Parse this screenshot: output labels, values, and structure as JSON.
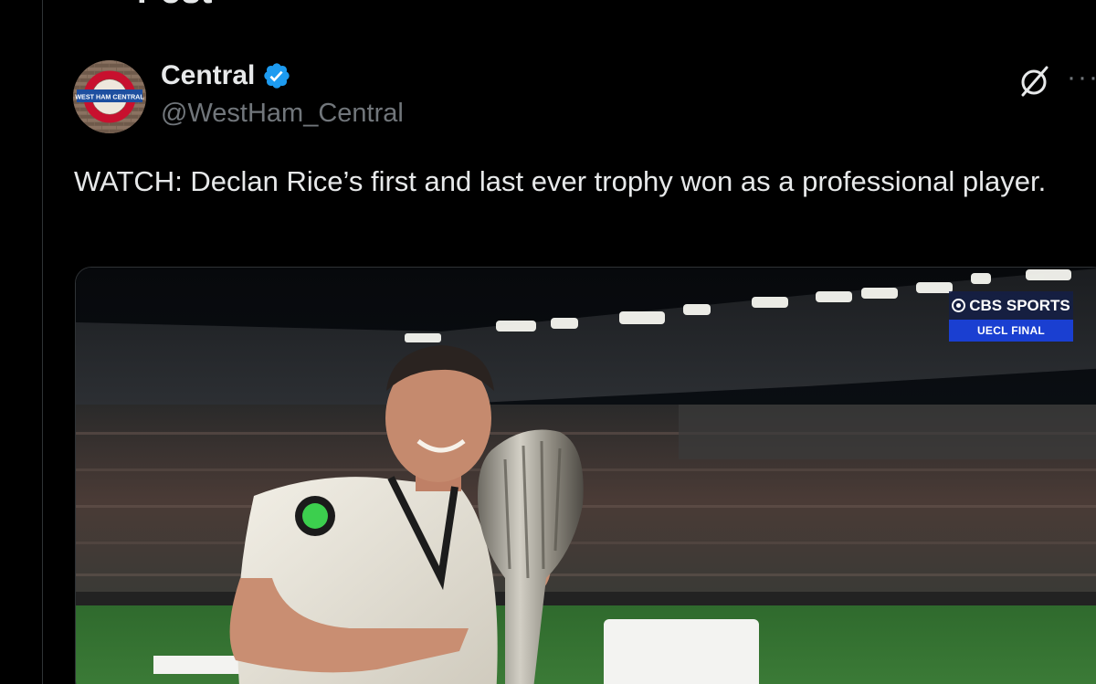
{
  "header": {
    "back_icon": "back-arrow-icon",
    "title": "Post"
  },
  "author": {
    "name": "Central",
    "handle": "@WestHam_Central",
    "verified_color": "#1d9bf0",
    "avatar_text": "WEST HAM CENTRAL"
  },
  "actions": {
    "grok_icon": "grok-icon",
    "more_icon": "more-icon",
    "more_glyph": "···"
  },
  "tweet": {
    "text": "WATCH: Declan Rice’s first and last ever trophy won as a professional player."
  },
  "media": {
    "type": "video",
    "broadcaster": "CBS SPORTS",
    "broadcast_label": "UECL FINAL"
  },
  "colors": {
    "background": "#000000",
    "primary_text": "#e7e9ea",
    "secondary_text": "#71767b",
    "verified_blue": "#1d9bf0",
    "cbs_blue": "#1a3fd1"
  }
}
